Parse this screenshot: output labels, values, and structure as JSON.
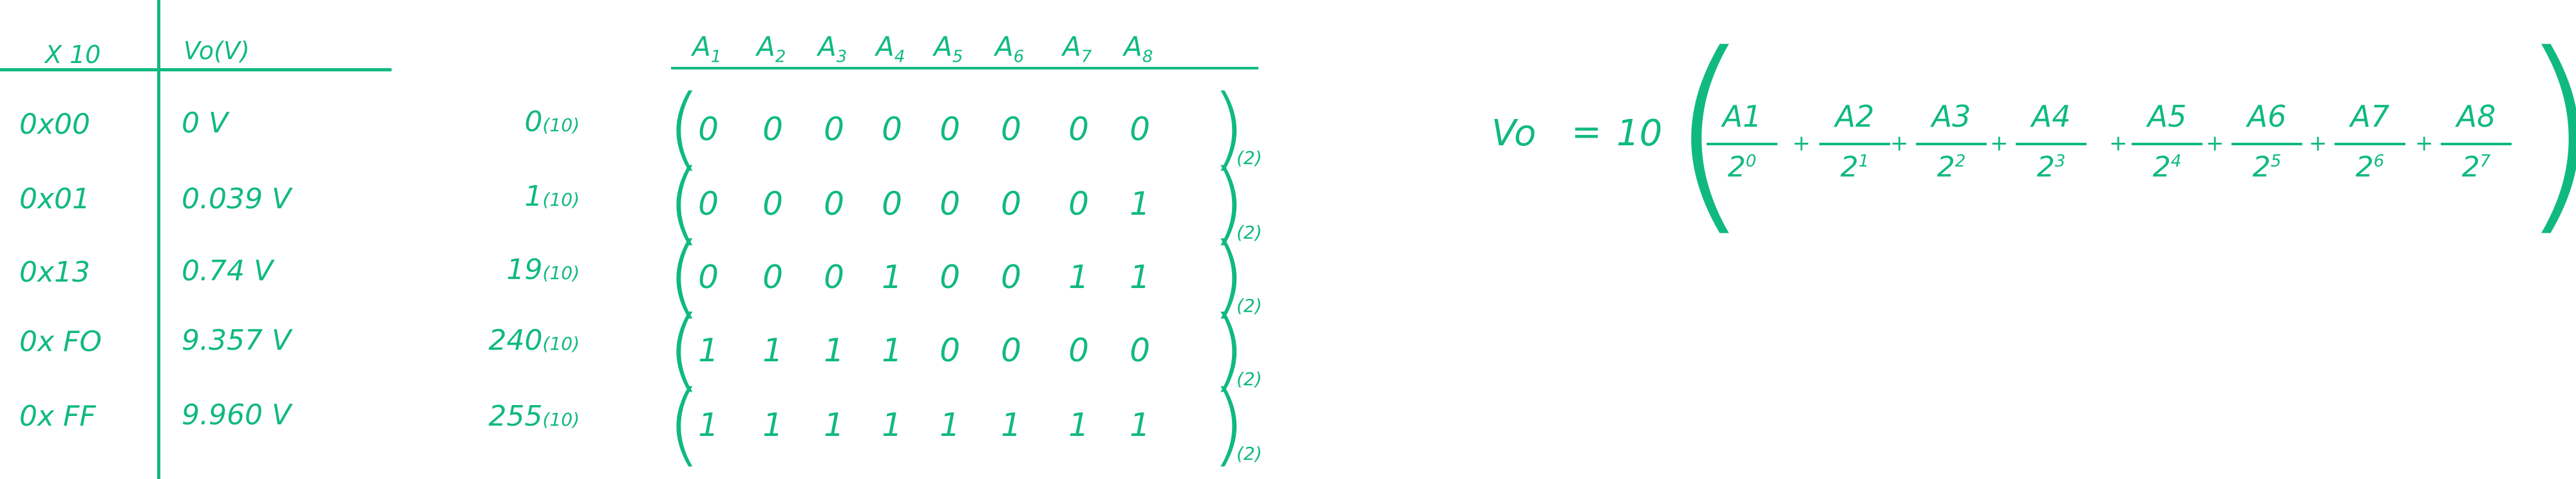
{
  "ink_color": "#10b981",
  "table": {
    "col1_header": "X 10",
    "col2_header": "Vo(V)",
    "rows": [
      {
        "hex": "0x00",
        "volt": "0 V",
        "dec": "0",
        "dec_sub": "(10)"
      },
      {
        "hex": "0x01",
        "volt": "0.039 V",
        "dec": "1",
        "dec_sub": "(10)"
      },
      {
        "hex": "0x13",
        "volt": "0.74 V",
        "dec": "19",
        "dec_sub": "(10)"
      },
      {
        "hex": "0x FO",
        "volt": "9.357 V",
        "dec": "240",
        "dec_sub": "(10)"
      },
      {
        "hex": "0x FF",
        "volt": "9.960 V",
        "dec": "255",
        "dec_sub": "(10)"
      }
    ]
  },
  "matrix": {
    "headers": [
      "A",
      "A",
      "A",
      "A",
      "A",
      "A",
      "A",
      "A"
    ],
    "header_subs": [
      "1",
      "2",
      "3",
      "4",
      "5",
      "6",
      "7",
      "8"
    ],
    "rows": [
      [
        "0",
        "0",
        "0",
        "0",
        "0",
        "0",
        "0",
        "0"
      ],
      [
        "0",
        "0",
        "0",
        "0",
        "0",
        "0",
        "0",
        "1"
      ],
      [
        "0",
        "0",
        "0",
        "1",
        "0",
        "0",
        "1",
        "1"
      ],
      [
        "1",
        "1",
        "1",
        "1",
        "0",
        "0",
        "0",
        "0"
      ],
      [
        "1",
        "1",
        "1",
        "1",
        "1",
        "1",
        "1",
        "1"
      ]
    ],
    "base_sub": "(2)"
  },
  "formula": {
    "lhs": "Vo",
    "equals": "=",
    "coef": "10",
    "numerators": [
      "A1",
      "A2",
      "A3",
      "A4",
      "A5",
      "A6",
      "A7",
      "A8"
    ],
    "den_base": "2",
    "den_exps": [
      "0",
      "1",
      "2",
      "3",
      "4",
      "5",
      "6",
      "7"
    ],
    "plus": "+"
  }
}
